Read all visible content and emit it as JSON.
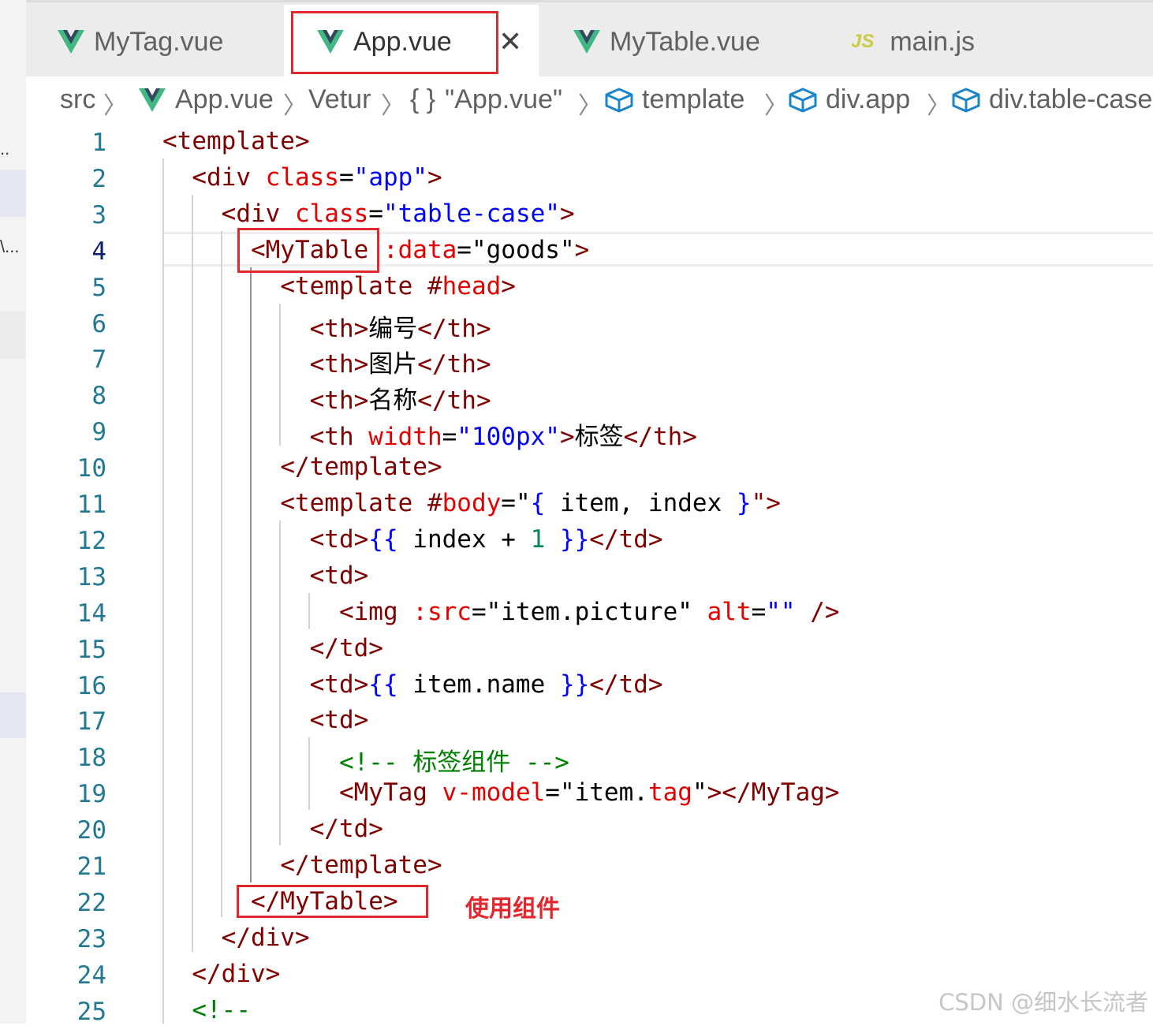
{
  "tabs": [
    {
      "label": "MyTag.vue",
      "icon": "vue-icon",
      "active": false
    },
    {
      "label": "App.vue",
      "icon": "vue-icon",
      "active": true
    },
    {
      "label": "MyTable.vue",
      "icon": "vue-icon",
      "active": false
    },
    {
      "label": "main.js",
      "icon": "js-icon",
      "active": false
    }
  ],
  "tab_close_glyph": "✕",
  "js_icon_text": "JS",
  "side": {
    "ellipsis_1": "..",
    "ellipsis_2": "\\..."
  },
  "breadcrumb": {
    "src": "src",
    "file": "App.vue",
    "vetur": "Vetur",
    "braces": "{ }",
    "module": "\"App.vue\"",
    "template": "template",
    "div_app": "div.app",
    "div_table": "div.table-case"
  },
  "current_line": 4,
  "line_numbers": [
    "1",
    "2",
    "3",
    "4",
    "5",
    "6",
    "7",
    "8",
    "9",
    "10",
    "11",
    "12",
    "13",
    "14",
    "15",
    "16",
    "17",
    "18",
    "19",
    "20",
    "21",
    "22",
    "23",
    "24",
    "25"
  ],
  "code": {
    "l1": "<template>",
    "l2": {
      "open": "<div ",
      "attr": "class",
      "eq": "=",
      "val": "\"app\"",
      "close": ">"
    },
    "l3": {
      "open": "<div ",
      "attr": "class",
      "eq": "=",
      "val": "\"table-case\"",
      "close": ">"
    },
    "l4": {
      "open": "<MyTable ",
      "attr": ":data",
      "eq": "=",
      "val": "\"goods\"",
      "close": ">"
    },
    "l5": {
      "open": "<template #",
      "attr": "head",
      "close": ">"
    },
    "l6": {
      "open": "<th>",
      "text": "编号",
      "close": "</th>"
    },
    "l7": {
      "open": "<th>",
      "text": "图片",
      "close": "</th>"
    },
    "l8": {
      "open": "<th>",
      "text": "名称",
      "close": "</th>"
    },
    "l9": {
      "open": "<th ",
      "attr": "width",
      "eq": "=",
      "val": "\"100px\"",
      "mid": ">",
      "text": "标签",
      "close": "</th>"
    },
    "l10": "</template>",
    "l11": {
      "open": "<template #",
      "attr": "body",
      "eq": "=\"",
      "b1": "{",
      "text": " item, index ",
      "b2": "}",
      "close": "\">"
    },
    "l12": {
      "open": "<td>",
      "b1": "{{",
      "text": " index + ",
      "num": "1",
      "sp": " ",
      "b2": "}}",
      "close": "</td>"
    },
    "l13": "<td>",
    "l14": {
      "open": "<img ",
      "attr1": ":src",
      "eq1": "=",
      "val1": "\"item.picture\"",
      "sp": " ",
      "attr2": "alt",
      "eq2": "=",
      "val2": "\"\"",
      "close": " />"
    },
    "l15": "</td>",
    "l16": {
      "open": "<td>",
      "b1": "{{",
      "text": " item.name ",
      "b2": "}}",
      "close": "</td>"
    },
    "l17": "<td>",
    "l18": "<!-- 标签组件 -->",
    "l19": {
      "open": "<MyTag ",
      "attr": "v-model",
      "eq": "=\"",
      "text": "item.",
      "attr2": "tag",
      "q": "\"",
      "close": "></MyTag>"
    },
    "l20": "</td>",
    "l21": "</template>",
    "l22": "</MyTable>",
    "l23": "</div>",
    "l24": "</div>",
    "l25": "<!--"
  },
  "annotation": "使用组件",
  "watermark": "CSDN @细水长流者",
  "colors": {
    "tag": "#800000",
    "attr": "#e50000",
    "string": "#0000ff",
    "comment": "#008000",
    "number": "#098658",
    "line_number": "#237893",
    "annotation": "#e0282e",
    "vue_green": "#41b883",
    "vue_dark": "#35495e"
  }
}
